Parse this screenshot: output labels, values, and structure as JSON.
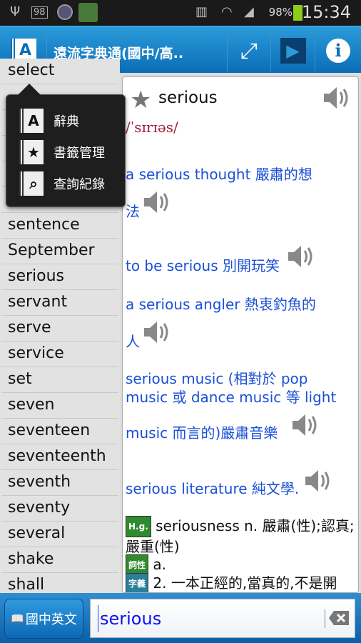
{
  "status_bar": {
    "battery_percent": "98%",
    "time": "15:34",
    "notification_badge": "98",
    "icons": [
      "usb-icon",
      "badge-98-icon",
      "app-icon",
      "target-app-icon",
      "vibrate-icon",
      "wifi-icon",
      "signal-icon",
      "battery-charging-icon"
    ]
  },
  "header": {
    "title": "遠流字典通(國中/高..",
    "buttons": [
      "app-logo",
      "fullscreen-icon",
      "play-icon",
      "info-icon"
    ]
  },
  "word_list": [
    "select",
    "",
    "",
    "",
    "",
    "",
    "sentence",
    "September",
    "serious",
    "servant",
    "serve",
    "service",
    "set",
    "seven",
    "seventeen",
    "seventeenth",
    "seventh",
    "seventy",
    "several",
    "shake",
    "shall"
  ],
  "menu": {
    "items": [
      {
        "label": "辭典",
        "icon": "A"
      },
      {
        "label": "書籤管理",
        "icon": "★"
      },
      {
        "label": "查詢紀錄",
        "icon": "⌕"
      }
    ]
  },
  "entry": {
    "headword": "serious",
    "phonetic": "/ˈsɪrɪəs/",
    "examples": [
      "a serious thought 嚴肅的想",
      "法",
      "to be serious 別開玩笑",
      "a serious angler 熱衷釣魚的",
      "人",
      "serious music (相對於 pop",
      "music 或 dance music 等 light",
      "music 而言的)嚴肅音樂",
      "serious literature 純文學."
    ],
    "derived_tag": "H.g.",
    "derived": "seriousness n. 嚴肅(性);認真;嚴重(性)",
    "pos_tag": "詞性",
    "pos": "a.",
    "sense_tag": "字義",
    "sense": "2. 一本正經的,當真的,不是開"
  },
  "bottom": {
    "dict_button": "國中英文",
    "search_value": "serious"
  },
  "colors": {
    "accent": "#0b6db8",
    "example_text": "#1a4fd8",
    "phonetic": "#a0203c",
    "tag_green": "#2e8b2e",
    "tag_teal": "#2a7f9a"
  }
}
